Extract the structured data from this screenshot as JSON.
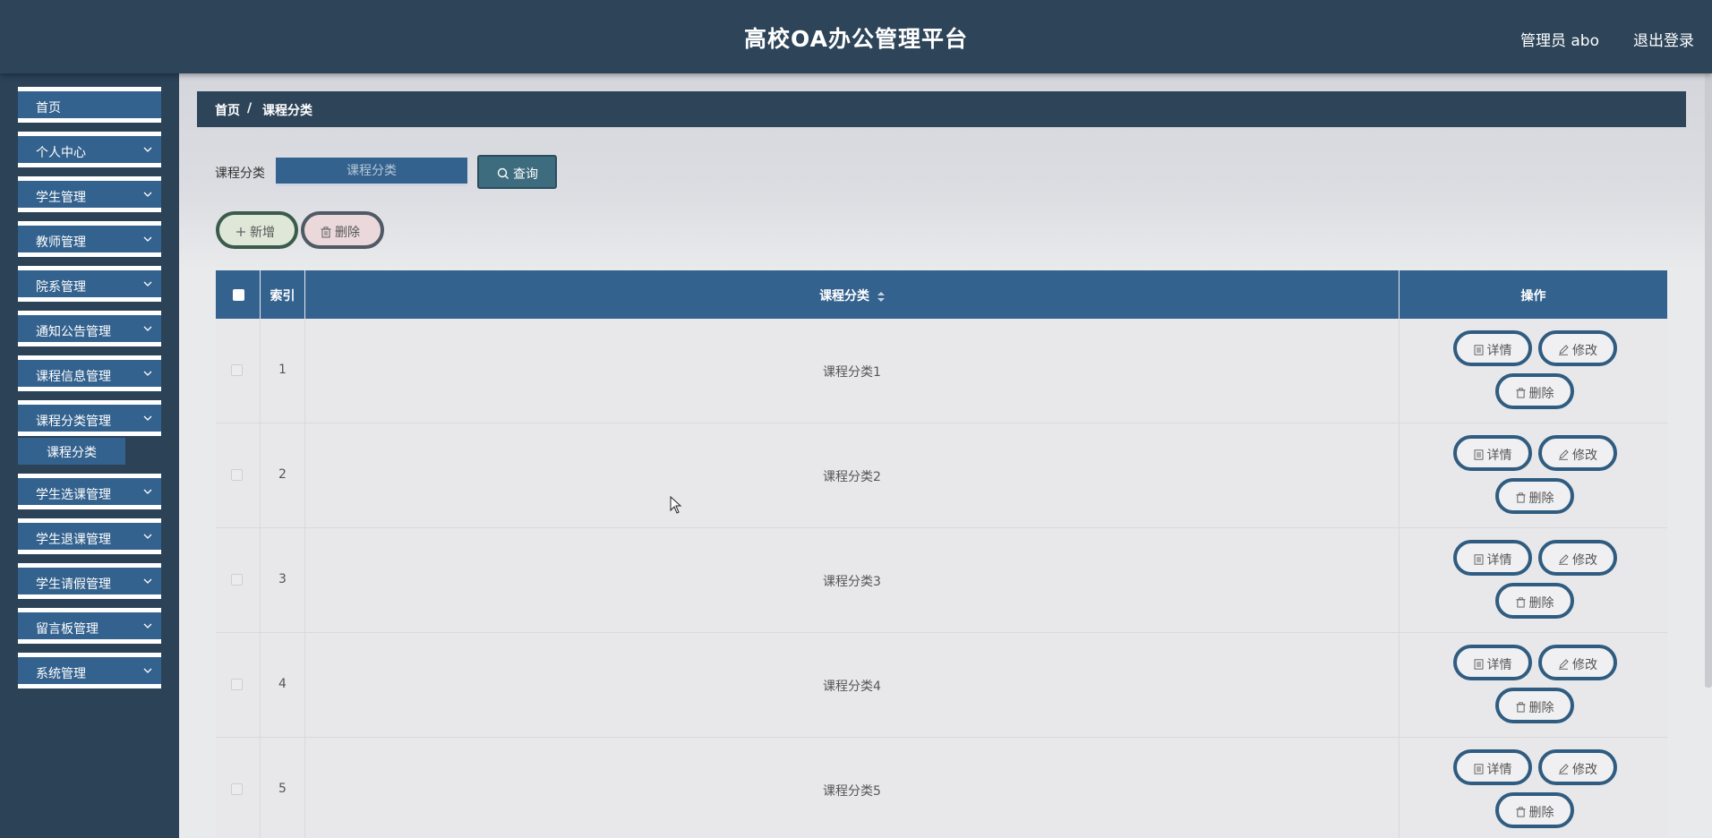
{
  "header": {
    "title": "高校OA办公管理平台",
    "user": "管理员 abo",
    "logout": "退出登录"
  },
  "sidebar": {
    "items": [
      {
        "label": "首页"
      },
      {
        "label": "个人中心"
      },
      {
        "label": "学生管理"
      },
      {
        "label": "教师管理"
      },
      {
        "label": "院系管理"
      },
      {
        "label": "通知公告管理"
      },
      {
        "label": "课程信息管理"
      },
      {
        "label": "课程分类管理"
      },
      {
        "label": "学生选课管理"
      },
      {
        "label": "学生退课管理"
      },
      {
        "label": "学生请假管理"
      },
      {
        "label": "留言板管理"
      },
      {
        "label": "系统管理"
      }
    ],
    "sub_item": "课程分类"
  },
  "breadcrumb": {
    "home": "首页",
    "sep": "/",
    "current": "课程分类"
  },
  "search": {
    "label": "课程分类",
    "placeholder": "课程分类",
    "button": "查询"
  },
  "actions": {
    "add": "新增",
    "delete": "删除"
  },
  "table": {
    "headers": {
      "index": "索引",
      "category": "课程分类",
      "ops": "操作"
    },
    "rows": [
      {
        "index": "1",
        "category": "课程分类1"
      },
      {
        "index": "2",
        "category": "课程分类2"
      },
      {
        "index": "3",
        "category": "课程分类3"
      },
      {
        "index": "4",
        "category": "课程分类4"
      },
      {
        "index": "5",
        "category": "课程分类5"
      }
    ],
    "row_buttons": {
      "detail": "详情",
      "edit": "修改",
      "delete": "删除"
    }
  },
  "colors": {
    "header_bg": "#2d4459",
    "accent": "#33628e",
    "content_bg": "#e9eaec"
  }
}
